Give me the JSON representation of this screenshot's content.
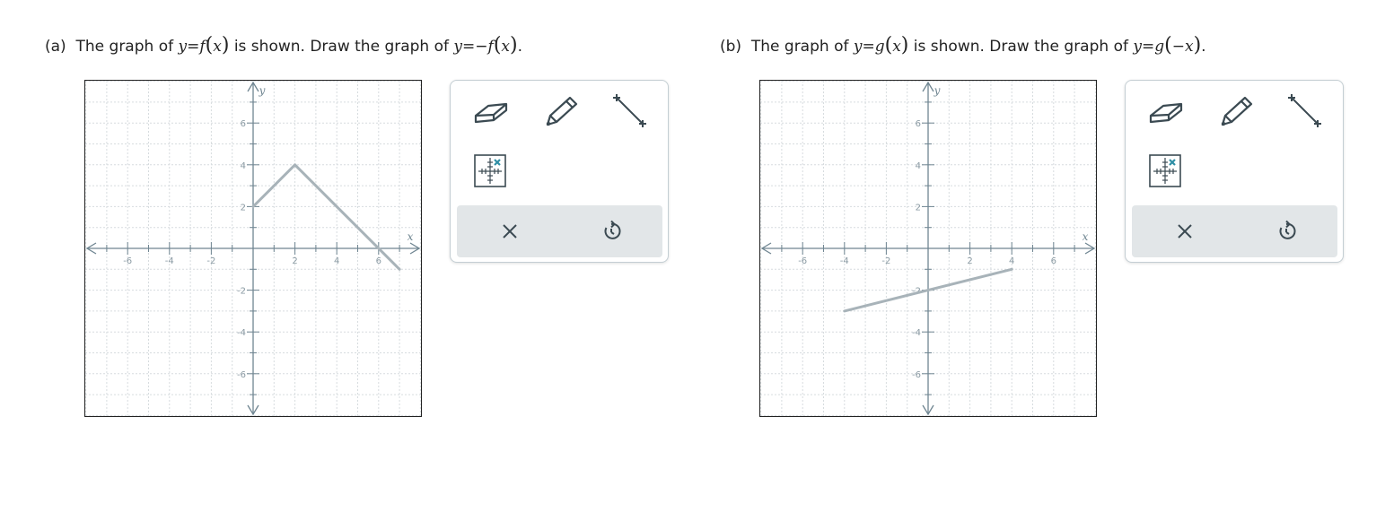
{
  "parts": [
    {
      "prompt_label": "(a)",
      "prompt_text1": "The graph of",
      "prompt_given": [
        "y",
        "=",
        "f",
        "(",
        "x",
        ")"
      ],
      "prompt_text2": "is shown. Draw the graph of",
      "prompt_target": [
        "y",
        "=",
        "−",
        "f",
        "(",
        "x",
        ")"
      ],
      "graph": {
        "x_label": "x",
        "y_label": "y",
        "x_ticks": [
          "-6",
          "-4",
          "-2",
          "2",
          "4",
          "6"
        ],
        "y_ticks": [
          "6",
          "4",
          "2",
          "-2",
          "-4",
          "-6"
        ],
        "curve_points": [
          [
            0,
            2
          ],
          [
            2,
            4
          ],
          [
            7,
            -1
          ]
        ]
      }
    },
    {
      "prompt_label": "(b)",
      "prompt_text1": "The graph of",
      "prompt_given": [
        "y",
        "=",
        "g",
        "(",
        "x",
        ")"
      ],
      "prompt_text2": "is shown. Draw the graph of",
      "prompt_target": [
        "y",
        "=",
        "g",
        "(",
        "−x",
        ")"
      ],
      "graph": {
        "x_label": "x",
        "y_label": "y",
        "x_ticks": [
          "-6",
          "-4",
          "-2",
          "2",
          "4",
          "6"
        ],
        "y_ticks": [
          "6",
          "4",
          "2",
          "-2",
          "-4",
          "-6"
        ],
        "curve_points": [
          [
            -4,
            -3
          ],
          [
            4,
            -1
          ]
        ]
      }
    }
  ],
  "toolbox": {
    "tools": [
      "eraser-icon",
      "pencil-icon",
      "line-segment-icon",
      "point-grid-icon"
    ],
    "actions": [
      "clear-icon",
      "undo-icon"
    ]
  },
  "colors": {
    "axis": "#6f8591",
    "grid": "#d7dcdf",
    "curve": "#a8b3b9",
    "icon": "#3b4a52",
    "accent": "#2f8fa6",
    "actionbar": "#e2e6e8"
  }
}
